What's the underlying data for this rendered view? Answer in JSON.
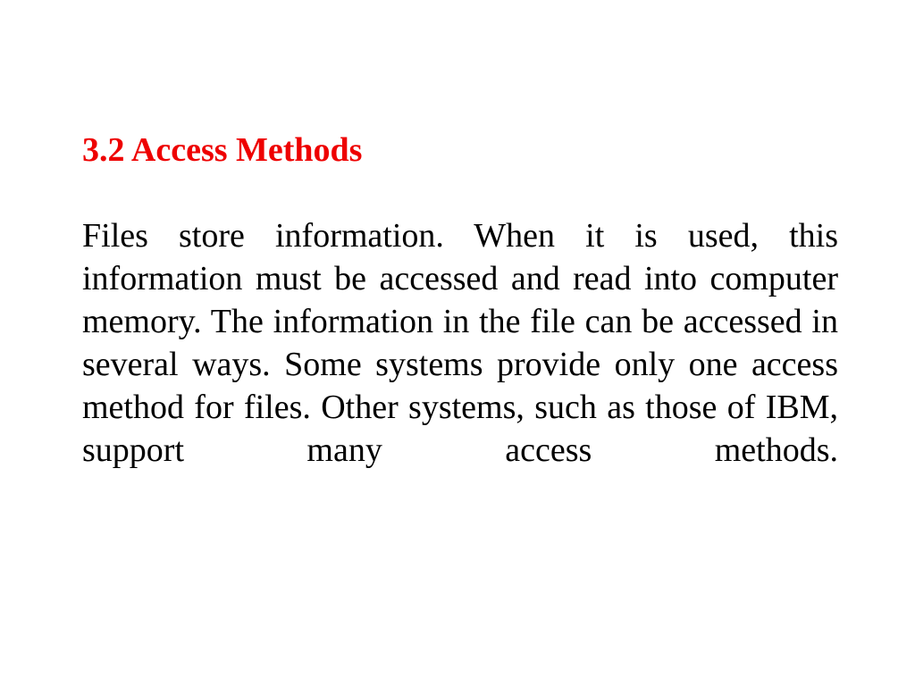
{
  "slide": {
    "background_color": "#ffffff",
    "heading": {
      "number": "3.2",
      "title": "Access Methods",
      "full_text": "3.2 Access Methods",
      "color": "#ee0000"
    },
    "body": {
      "color": "#000000",
      "alignment": "justify",
      "paragraph": "Files store information. When it is used, this information must be accessed and read into computer memory. The information in the file can be accessed in several ways. Some systems provide only one access method for files. Other systems, such as those of IBM, support many access methods.",
      "lines": [
        "Files store information. When it is used, this",
        "information must be accessed and read into",
        "computer memory. The information in the file can",
        "be accessed in several ways. Some systems provide",
        "only one access method for files. Other systems,",
        "such as those of IBM, support many access",
        "methods."
      ]
    }
  }
}
